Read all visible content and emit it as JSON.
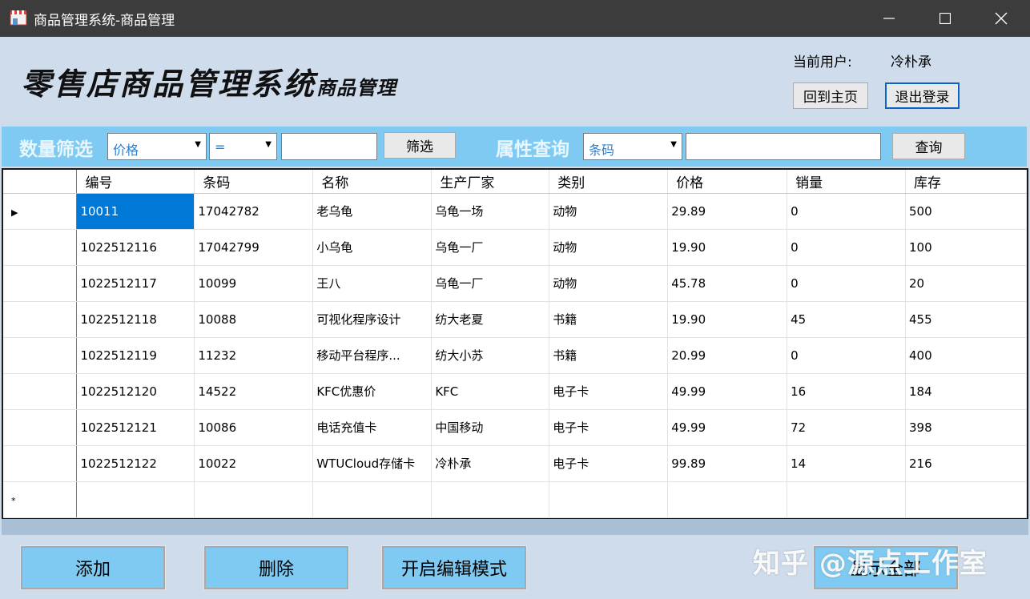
{
  "window": {
    "title": "商品管理系统-商品管理"
  },
  "header": {
    "logo_main": "零售店商品管理系统",
    "logo_sub": "商品管理",
    "current_user_label": "当前用户:",
    "current_user_value": "冷朴承",
    "home_button": "回到主页",
    "logout_button": "退出登录"
  },
  "filter": {
    "quantity_label": "数量筛选",
    "field_select": "价格",
    "operator_select": "=",
    "value_input": "",
    "filter_button": "筛选",
    "attr_label": "属性查询",
    "attr_select": "条码",
    "attr_input": "",
    "query_button": "查询"
  },
  "grid": {
    "columns": [
      "编号",
      "条码",
      "名称",
      "生产厂家",
      "类别",
      "价格",
      "销量",
      "库存"
    ],
    "rows": [
      [
        "10011",
        "17042782",
        "老乌龟",
        "乌龟一场",
        "动物",
        "29.89",
        "0",
        "500"
      ],
      [
        "1022512116",
        "17042799",
        "小乌龟",
        "乌龟一厂",
        "动物",
        "19.90",
        "0",
        "100"
      ],
      [
        "1022512117",
        "10099",
        "王八",
        "乌龟一厂",
        "动物",
        "45.78",
        "0",
        "20"
      ],
      [
        "1022512118",
        "10088",
        "可视化程序设计",
        "纺大老夏",
        "书籍",
        "19.90",
        "45",
        "455"
      ],
      [
        "1022512119",
        "11232",
        "移动平台程序...",
        "纺大小苏",
        "书籍",
        "20.99",
        "0",
        "400"
      ],
      [
        "1022512120",
        "14522",
        "KFC优惠价",
        "KFC",
        "电子卡",
        "49.99",
        "16",
        "184"
      ],
      [
        "1022512121",
        "10086",
        "电话充值卡",
        "中国移动",
        "电子卡",
        "49.99",
        "72",
        "398"
      ],
      [
        "1022512122",
        "10022",
        "WTUCloud存储卡",
        "冷朴承",
        "电子卡",
        "99.89",
        "14",
        "216"
      ]
    ],
    "current_row_marker": "▶",
    "new_row_marker": "*"
  },
  "actions": {
    "add": "添加",
    "delete": "删除",
    "edit_mode": "开启编辑模式",
    "show_all": "显示全部"
  },
  "watermark": "知乎 @源点工作室",
  "colors": {
    "accent": "#7fcaf2",
    "selection": "#0078d7",
    "titlebar": "#3c3c3c"
  }
}
